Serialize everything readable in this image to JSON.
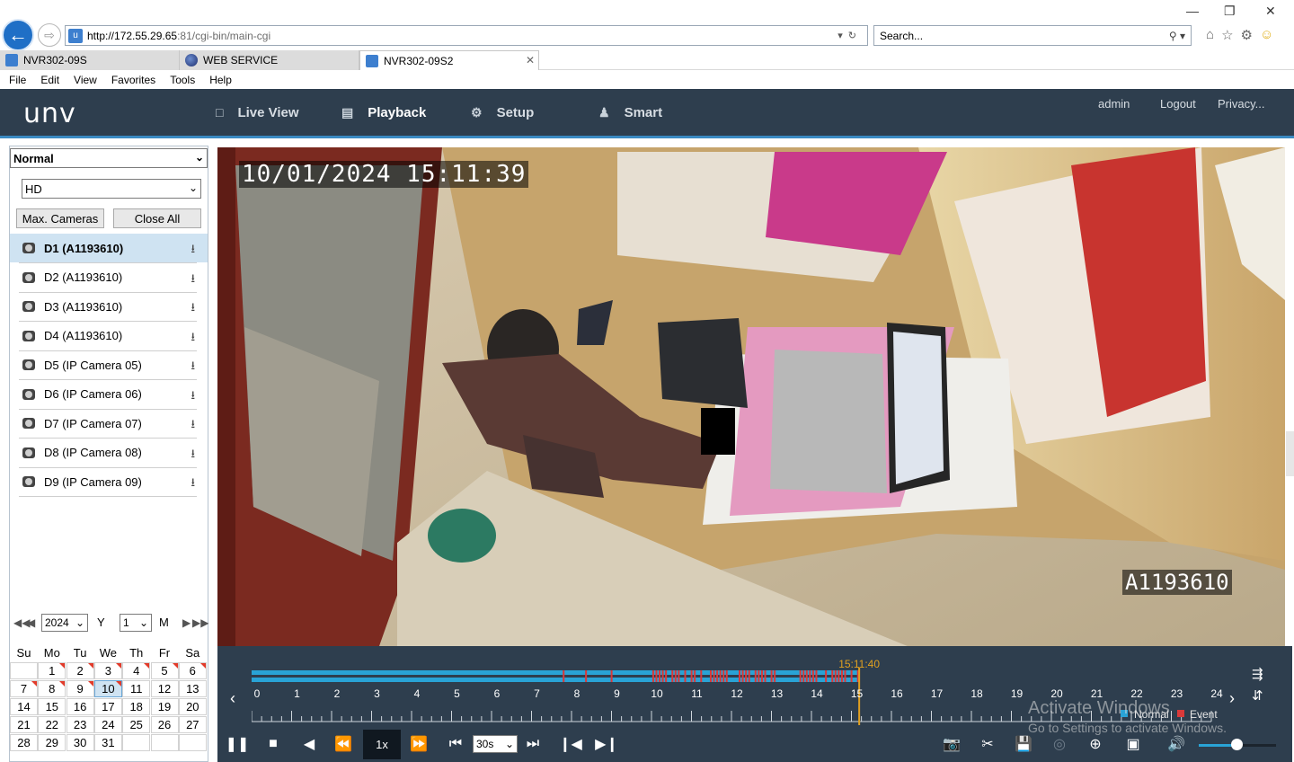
{
  "browser": {
    "address_host": "http://172.55.29.65",
    "address_path": ":81/cgi-bin/main-cgi",
    "search_placeholder": "Search...",
    "tabs": [
      {
        "label": "NVR302-09S",
        "active": false
      },
      {
        "label": "WEB SERVICE",
        "active": false
      },
      {
        "label": "NVR302-09S2",
        "active": true
      }
    ],
    "menu": [
      "File",
      "Edit",
      "View",
      "Favorites",
      "Tools",
      "Help"
    ]
  },
  "app": {
    "logo": "unv",
    "nav": [
      {
        "label": "Live View",
        "icon": "monitor-icon",
        "active": false
      },
      {
        "label": "Playback",
        "icon": "playback-icon",
        "active": true
      },
      {
        "label": "Setup",
        "icon": "gear-icon",
        "active": false
      },
      {
        "label": "Smart",
        "icon": "smart-icon",
        "active": false
      }
    ],
    "user": "admin",
    "logout": "Logout",
    "privacy": "Privacy..."
  },
  "left_panel": {
    "mode_select": "Normal",
    "stream_select": "HD",
    "max_cameras_btn": "Max. Cameras",
    "close_all_btn": "Close All",
    "cameras": [
      {
        "label": "D1 (A1193610)",
        "selected": true
      },
      {
        "label": "D2 (A1193610)",
        "selected": false
      },
      {
        "label": "D3 (A1193610)",
        "selected": false
      },
      {
        "label": "D4 (A1193610)",
        "selected": false
      },
      {
        "label": "D5 (IP Camera 05)",
        "selected": false
      },
      {
        "label": "D6 (IP Camera 06)",
        "selected": false
      },
      {
        "label": "D7 (IP Camera 07)",
        "selected": false
      },
      {
        "label": "D8 (IP Camera 08)",
        "selected": false
      },
      {
        "label": "D9 (IP Camera 09)",
        "selected": false
      }
    ],
    "calendar": {
      "year": "2024",
      "year_unit": "Y",
      "month": "1",
      "month_unit": "M",
      "weekdays": [
        "Su",
        "Mo",
        "Tu",
        "We",
        "Th",
        "Fr",
        "Sa"
      ],
      "weeks": [
        [
          "",
          "1",
          "2",
          "3",
          "4",
          "5",
          "6"
        ],
        [
          "7",
          "8",
          "9",
          "10",
          "11",
          "12",
          "13"
        ],
        [
          "14",
          "15",
          "16",
          "17",
          "18",
          "19",
          "20"
        ],
        [
          "21",
          "22",
          "23",
          "24",
          "25",
          "26",
          "27"
        ],
        [
          "28",
          "29",
          "30",
          "31",
          "",
          "",
          ""
        ]
      ],
      "recorded_days": [
        "1",
        "2",
        "3",
        "4",
        "5",
        "6",
        "7",
        "8",
        "9",
        "10"
      ],
      "selected_day": "10"
    }
  },
  "video": {
    "timestamp": "10/01/2024 15:11:39",
    "camera_name": "A1193610"
  },
  "timeline": {
    "current_time": "15:11:40",
    "current_hour": 15.194,
    "hours": [
      "0",
      "1",
      "2",
      "3",
      "4",
      "5",
      "6",
      "7",
      "8",
      "9",
      "10",
      "11",
      "12",
      "13",
      "14",
      "15",
      "16",
      "17",
      "18",
      "19",
      "20",
      "21",
      "22",
      "23",
      "24"
    ],
    "legend_normal": "Normal",
    "legend_event": "Event",
    "colors": {
      "normal": "#29a3d6",
      "event": "#d9393a",
      "cursor": "#e0a020"
    }
  },
  "controls": {
    "speed": "1x",
    "interval": "30s"
  },
  "watermark": {
    "line1": "Activate Windows",
    "line2": "Go to Settings to activate Windows."
  }
}
